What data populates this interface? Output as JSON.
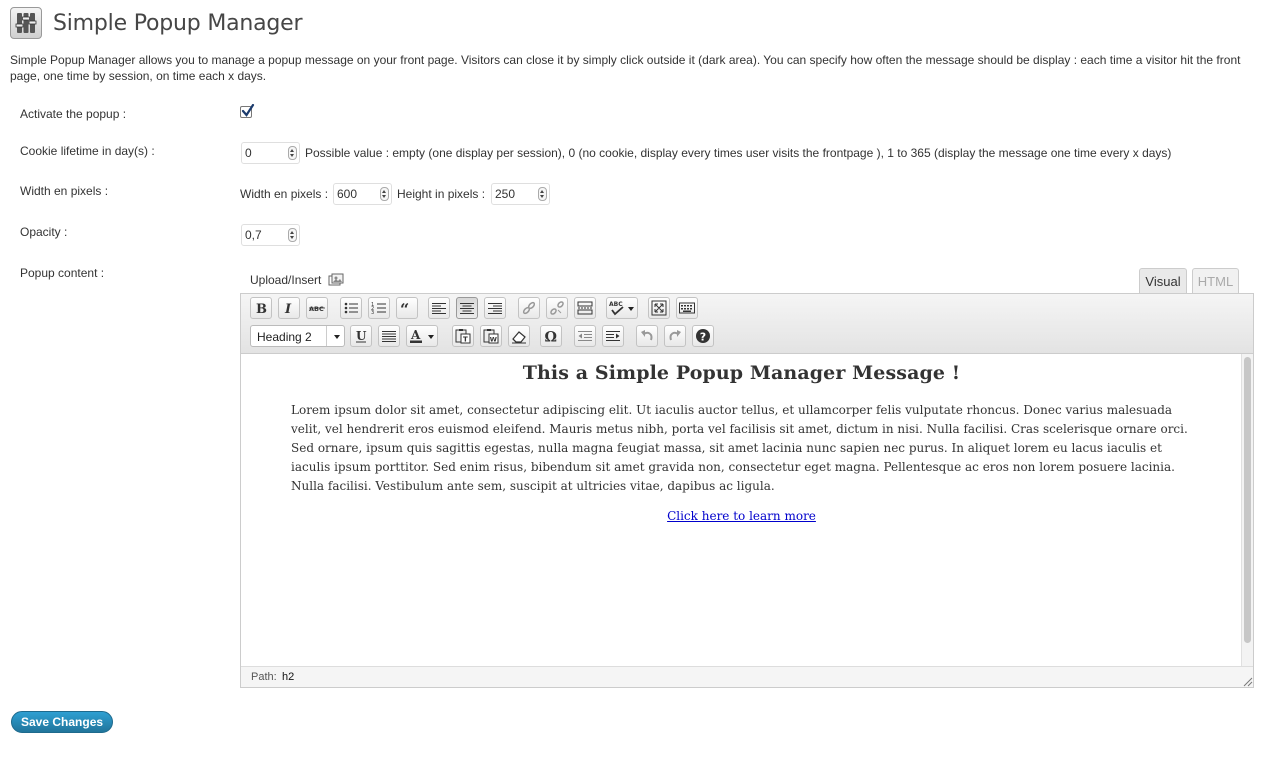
{
  "header": {
    "title": "Simple Popup Manager",
    "icon": "settings-sliders-icon"
  },
  "description": "Simple Popup Manager allows you to manage a popup message on your front page. Visitors can close it by simply click outside it (dark area). You can specify how often the message should be display : each time a visitor hit the front page, one time by session, on time each x days.",
  "form": {
    "activate": {
      "label": "Activate the popup :",
      "checked": true
    },
    "cookie": {
      "label": "Cookie lifetime in day(s) :",
      "value": "0",
      "hint": "Possible value : empty (one display per session), 0 (no cookie, display every times user visits the frontpage ), 1 to 365 (display the message one time every x days)"
    },
    "size": {
      "label": "Width en pixels :",
      "width_label": "Width en pixels :",
      "width_value": "600",
      "height_label": "Height in pixels :",
      "height_value": "250"
    },
    "opacity": {
      "label": "Opacity :",
      "value": "0,7"
    },
    "content": {
      "label": "Popup content :"
    }
  },
  "editor": {
    "upload_insert": "Upload/Insert",
    "tabs": {
      "visual": "Visual",
      "html": "HTML",
      "active": "visual"
    },
    "format_select": "Heading 2",
    "heading": "This a Simple Popup Manager Message !",
    "body": "Lorem ipsum dolor sit amet, consectetur adipiscing elit. Ut iaculis auctor tellus, et ullamcorper felis vulputate rhoncus. Donec varius malesuada velit, vel hendrerit eros euismod eleifend. Mauris metus nibh, porta vel facilisis sit amet, dictum in nisi. Nulla facilisi. Cras scelerisque ornare orci. Sed ornare, ipsum quis sagittis egestas, nulla magna feugiat massa, sit amet lacinia nunc sapien nec purus. In aliquet lorem eu lacus iaculis et iaculis ipsum porttitor. Sed enim risus, bibendum sit amet gravida non, consectetur eget magna. Pellentesque ac eros non lorem posuere lacinia. Nulla facilisi. Vestibulum ante sem, suscipit at ultricies vitae, dapibus ac ligula.",
    "link_text": "Click here to learn more",
    "path_label": "Path:",
    "path_value": "h2"
  },
  "save_button": "Save Changes",
  "colors": {
    "button_top": "#2e9fd2",
    "button_bottom": "#21759b",
    "link": "#0000cc"
  }
}
